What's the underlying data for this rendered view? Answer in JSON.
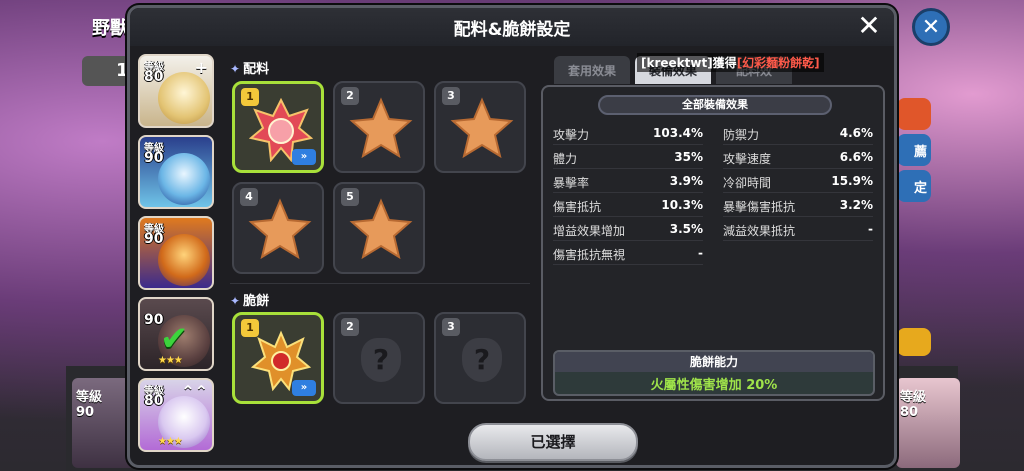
{
  "background": {
    "title": "野獸",
    "tab_number": "1",
    "close_icon": "close-icon",
    "right_buttons": [
      "",
      "薦",
      "定",
      ""
    ],
    "bottom_cards": [
      {
        "level_label": "等級",
        "level": "90"
      },
      {
        "level_label": "等級",
        "level": "80"
      }
    ]
  },
  "modal": {
    "title": "配料&脆餅設定",
    "close_label": "✕"
  },
  "cookies": [
    {
      "level_label": "等級",
      "level": "80",
      "corner": "+",
      "stars": "",
      "checked": false
    },
    {
      "level_label": "等級",
      "level": "90",
      "corner": "",
      "stars": "",
      "checked": false
    },
    {
      "level_label": "等級",
      "level": "90",
      "corner": "",
      "stars": "",
      "checked": false
    },
    {
      "level_label": "",
      "level": "90",
      "corner": "",
      "stars": "★★★",
      "checked": true
    },
    {
      "level_label": "等級",
      "level": "80",
      "corner": "⌃⌃",
      "stars": "★★★",
      "checked": false
    }
  ],
  "toppings": {
    "label": "配料",
    "slots": [
      "1",
      "2",
      "3",
      "4",
      "5"
    ],
    "upgrade_label": "»"
  },
  "biscuit": {
    "label": "脆餅",
    "slots": [
      "1",
      "2",
      "3"
    ],
    "unknown_label": "?",
    "upgrade_label": "»"
  },
  "tabs": [
    {
      "label": "套用效果",
      "selected": false
    },
    {
      "label": "裝備效果",
      "selected": true
    },
    {
      "label": "配料效",
      "selected": false
    }
  ],
  "notice": {
    "text": "[kreektwt]獲得",
    "item": "[幻彩麵粉餅乾]"
  },
  "effects": {
    "header": "全部裝備效果",
    "left": [
      {
        "name": "攻擊力",
        "value": "103.4%"
      },
      {
        "name": "體力",
        "value": "35%"
      },
      {
        "name": "暴擊率",
        "value": "3.9%"
      },
      {
        "name": "傷害抵抗",
        "value": "10.3%"
      },
      {
        "name": "增益效果增加",
        "value": "3.5%"
      },
      {
        "name": "傷害抵抗無視",
        "value": "-"
      }
    ],
    "right": [
      {
        "name": "防禦力",
        "value": "4.6%"
      },
      {
        "name": "攻擊速度",
        "value": "6.6%"
      },
      {
        "name": "冷卻時間",
        "value": "15.9%"
      },
      {
        "name": "暴擊傷害抵抗",
        "value": "3.2%"
      },
      {
        "name": "減益效果抵抗",
        "value": "-"
      }
    ],
    "ability_title": "脆餅能力",
    "ability_value": "火屬性傷害增加 20%"
  },
  "confirm_label": "已選擇",
  "colors": {
    "accent_green": "#a8e03a",
    "ability_green": "#9fe34a",
    "notice_red": "#ff5a4a",
    "upgrade_blue": "#2f7fe0"
  }
}
